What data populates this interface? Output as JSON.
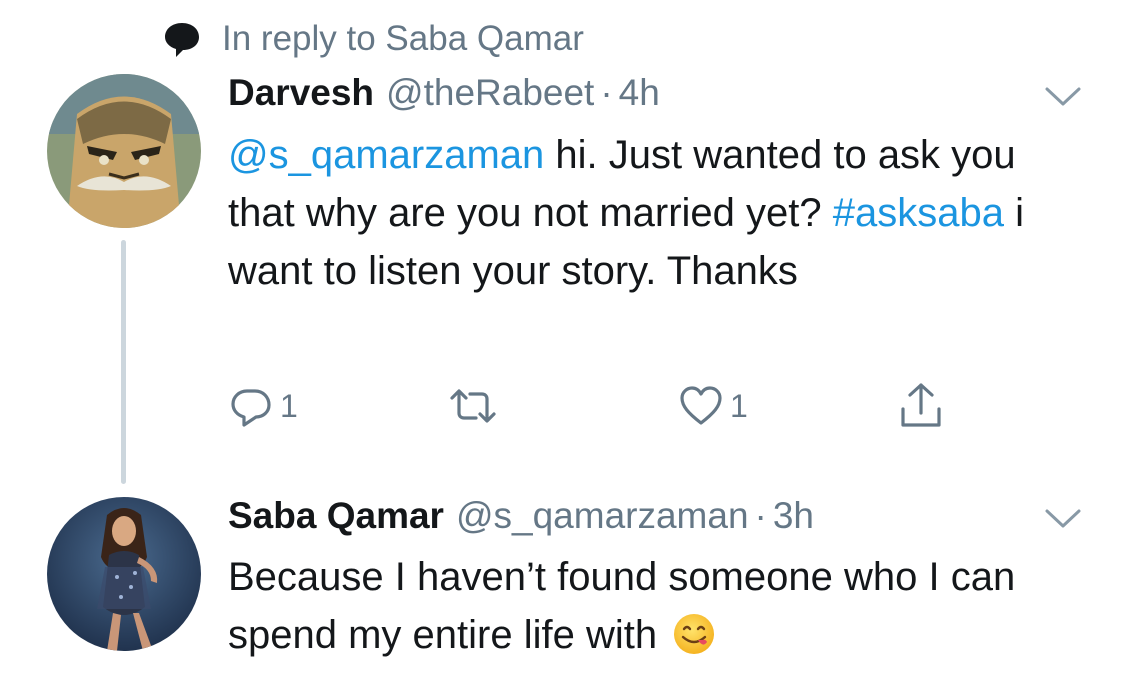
{
  "reply_context": {
    "text": "In reply to Saba Qamar",
    "icon": "speech-bubble-icon"
  },
  "tweets": [
    {
      "avatar_icon": "anime-old-man-avatar",
      "display_name": "Darvesh",
      "handle": "@theRabeet",
      "separator": "·",
      "time": "4h",
      "menu_icon": "chevron-down-icon",
      "body": {
        "mention": "@s_qamarzaman",
        "text_1": " hi. Just wanted to ask you that why are you not married yet? ",
        "hashtag": "#asksaba",
        "text_2": " i want to listen your story. Thanks"
      },
      "actions": {
        "reply_count": "1",
        "retweet_count": "",
        "like_count": "1"
      }
    },
    {
      "avatar_icon": "woman-portrait-avatar",
      "display_name": "Saba Qamar",
      "handle": "@s_qamarzaman",
      "separator": "·",
      "time": "3h",
      "menu_icon": "chevron-down-icon",
      "body": {
        "text": "Because I haven’t found someone who I can spend my entire life with ",
        "emoji": "yum-face-emoji"
      }
    }
  ],
  "colors": {
    "text": "#14171a",
    "muted": "#657786",
    "link": "#1b95e0",
    "thread_line": "#ccd6dd"
  }
}
